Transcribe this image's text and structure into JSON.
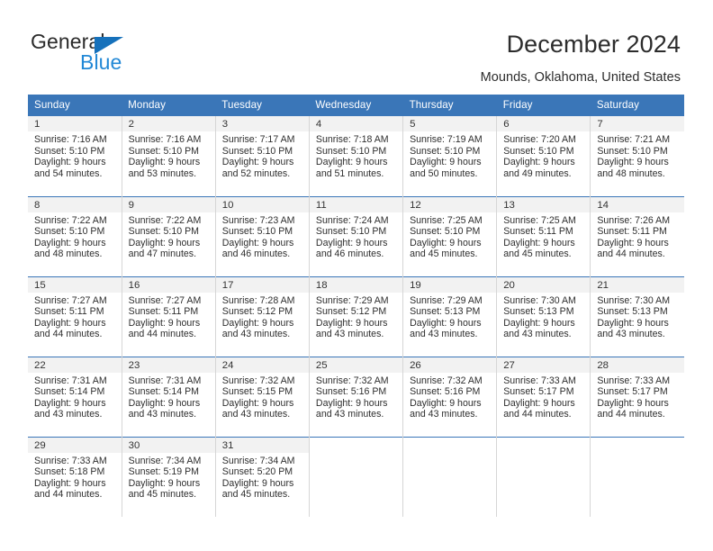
{
  "brand": {
    "name_part1": "General",
    "name_part2": "Blue",
    "accent_color": "#1671bb",
    "accent_color_light": "#2288d6"
  },
  "header": {
    "title": "December 2024",
    "subtitle": "Mounds, Oklahoma, United States"
  },
  "calendar": {
    "header_bg": "#3a76b8",
    "daynum_bg": "#f2f2f2",
    "weekday_headers": [
      "Sunday",
      "Monday",
      "Tuesday",
      "Wednesday",
      "Thursday",
      "Friday",
      "Saturday"
    ],
    "weeks": [
      [
        {
          "day": "1",
          "sunrise": "Sunrise: 7:16 AM",
          "sunset": "Sunset: 5:10 PM",
          "daylight_line1": "Daylight: 9 hours",
          "daylight_line2": "and 54 minutes."
        },
        {
          "day": "2",
          "sunrise": "Sunrise: 7:16 AM",
          "sunset": "Sunset: 5:10 PM",
          "daylight_line1": "Daylight: 9 hours",
          "daylight_line2": "and 53 minutes."
        },
        {
          "day": "3",
          "sunrise": "Sunrise: 7:17 AM",
          "sunset": "Sunset: 5:10 PM",
          "daylight_line1": "Daylight: 9 hours",
          "daylight_line2": "and 52 minutes."
        },
        {
          "day": "4",
          "sunrise": "Sunrise: 7:18 AM",
          "sunset": "Sunset: 5:10 PM",
          "daylight_line1": "Daylight: 9 hours",
          "daylight_line2": "and 51 minutes."
        },
        {
          "day": "5",
          "sunrise": "Sunrise: 7:19 AM",
          "sunset": "Sunset: 5:10 PM",
          "daylight_line1": "Daylight: 9 hours",
          "daylight_line2": "and 50 minutes."
        },
        {
          "day": "6",
          "sunrise": "Sunrise: 7:20 AM",
          "sunset": "Sunset: 5:10 PM",
          "daylight_line1": "Daylight: 9 hours",
          "daylight_line2": "and 49 minutes."
        },
        {
          "day": "7",
          "sunrise": "Sunrise: 7:21 AM",
          "sunset": "Sunset: 5:10 PM",
          "daylight_line1": "Daylight: 9 hours",
          "daylight_line2": "and 48 minutes."
        }
      ],
      [
        {
          "day": "8",
          "sunrise": "Sunrise: 7:22 AM",
          "sunset": "Sunset: 5:10 PM",
          "daylight_line1": "Daylight: 9 hours",
          "daylight_line2": "and 48 minutes."
        },
        {
          "day": "9",
          "sunrise": "Sunrise: 7:22 AM",
          "sunset": "Sunset: 5:10 PM",
          "daylight_line1": "Daylight: 9 hours",
          "daylight_line2": "and 47 minutes."
        },
        {
          "day": "10",
          "sunrise": "Sunrise: 7:23 AM",
          "sunset": "Sunset: 5:10 PM",
          "daylight_line1": "Daylight: 9 hours",
          "daylight_line2": "and 46 minutes."
        },
        {
          "day": "11",
          "sunrise": "Sunrise: 7:24 AM",
          "sunset": "Sunset: 5:10 PM",
          "daylight_line1": "Daylight: 9 hours",
          "daylight_line2": "and 46 minutes."
        },
        {
          "day": "12",
          "sunrise": "Sunrise: 7:25 AM",
          "sunset": "Sunset: 5:10 PM",
          "daylight_line1": "Daylight: 9 hours",
          "daylight_line2": "and 45 minutes."
        },
        {
          "day": "13",
          "sunrise": "Sunrise: 7:25 AM",
          "sunset": "Sunset: 5:11 PM",
          "daylight_line1": "Daylight: 9 hours",
          "daylight_line2": "and 45 minutes."
        },
        {
          "day": "14",
          "sunrise": "Sunrise: 7:26 AM",
          "sunset": "Sunset: 5:11 PM",
          "daylight_line1": "Daylight: 9 hours",
          "daylight_line2": "and 44 minutes."
        }
      ],
      [
        {
          "day": "15",
          "sunrise": "Sunrise: 7:27 AM",
          "sunset": "Sunset: 5:11 PM",
          "daylight_line1": "Daylight: 9 hours",
          "daylight_line2": "and 44 minutes."
        },
        {
          "day": "16",
          "sunrise": "Sunrise: 7:27 AM",
          "sunset": "Sunset: 5:11 PM",
          "daylight_line1": "Daylight: 9 hours",
          "daylight_line2": "and 44 minutes."
        },
        {
          "day": "17",
          "sunrise": "Sunrise: 7:28 AM",
          "sunset": "Sunset: 5:12 PM",
          "daylight_line1": "Daylight: 9 hours",
          "daylight_line2": "and 43 minutes."
        },
        {
          "day": "18",
          "sunrise": "Sunrise: 7:29 AM",
          "sunset": "Sunset: 5:12 PM",
          "daylight_line1": "Daylight: 9 hours",
          "daylight_line2": "and 43 minutes."
        },
        {
          "day": "19",
          "sunrise": "Sunrise: 7:29 AM",
          "sunset": "Sunset: 5:13 PM",
          "daylight_line1": "Daylight: 9 hours",
          "daylight_line2": "and 43 minutes."
        },
        {
          "day": "20",
          "sunrise": "Sunrise: 7:30 AM",
          "sunset": "Sunset: 5:13 PM",
          "daylight_line1": "Daylight: 9 hours",
          "daylight_line2": "and 43 minutes."
        },
        {
          "day": "21",
          "sunrise": "Sunrise: 7:30 AM",
          "sunset": "Sunset: 5:13 PM",
          "daylight_line1": "Daylight: 9 hours",
          "daylight_line2": "and 43 minutes."
        }
      ],
      [
        {
          "day": "22",
          "sunrise": "Sunrise: 7:31 AM",
          "sunset": "Sunset: 5:14 PM",
          "daylight_line1": "Daylight: 9 hours",
          "daylight_line2": "and 43 minutes."
        },
        {
          "day": "23",
          "sunrise": "Sunrise: 7:31 AM",
          "sunset": "Sunset: 5:14 PM",
          "daylight_line1": "Daylight: 9 hours",
          "daylight_line2": "and 43 minutes."
        },
        {
          "day": "24",
          "sunrise": "Sunrise: 7:32 AM",
          "sunset": "Sunset: 5:15 PM",
          "daylight_line1": "Daylight: 9 hours",
          "daylight_line2": "and 43 minutes."
        },
        {
          "day": "25",
          "sunrise": "Sunrise: 7:32 AM",
          "sunset": "Sunset: 5:16 PM",
          "daylight_line1": "Daylight: 9 hours",
          "daylight_line2": "and 43 minutes."
        },
        {
          "day": "26",
          "sunrise": "Sunrise: 7:32 AM",
          "sunset": "Sunset: 5:16 PM",
          "daylight_line1": "Daylight: 9 hours",
          "daylight_line2": "and 43 minutes."
        },
        {
          "day": "27",
          "sunrise": "Sunrise: 7:33 AM",
          "sunset": "Sunset: 5:17 PM",
          "daylight_line1": "Daylight: 9 hours",
          "daylight_line2": "and 44 minutes."
        },
        {
          "day": "28",
          "sunrise": "Sunrise: 7:33 AM",
          "sunset": "Sunset: 5:17 PM",
          "daylight_line1": "Daylight: 9 hours",
          "daylight_line2": "and 44 minutes."
        }
      ],
      [
        {
          "day": "29",
          "sunrise": "Sunrise: 7:33 AM",
          "sunset": "Sunset: 5:18 PM",
          "daylight_line1": "Daylight: 9 hours",
          "daylight_line2": "and 44 minutes."
        },
        {
          "day": "30",
          "sunrise": "Sunrise: 7:34 AM",
          "sunset": "Sunset: 5:19 PM",
          "daylight_line1": "Daylight: 9 hours",
          "daylight_line2": "and 45 minutes."
        },
        {
          "day": "31",
          "sunrise": "Sunrise: 7:34 AM",
          "sunset": "Sunset: 5:20 PM",
          "daylight_line1": "Daylight: 9 hours",
          "daylight_line2": "and 45 minutes."
        },
        {
          "day": "",
          "sunrise": "",
          "sunset": "",
          "daylight_line1": "",
          "daylight_line2": ""
        },
        {
          "day": "",
          "sunrise": "",
          "sunset": "",
          "daylight_line1": "",
          "daylight_line2": ""
        },
        {
          "day": "",
          "sunrise": "",
          "sunset": "",
          "daylight_line1": "",
          "daylight_line2": ""
        },
        {
          "day": "",
          "sunrise": "",
          "sunset": "",
          "daylight_line1": "",
          "daylight_line2": ""
        }
      ]
    ]
  }
}
